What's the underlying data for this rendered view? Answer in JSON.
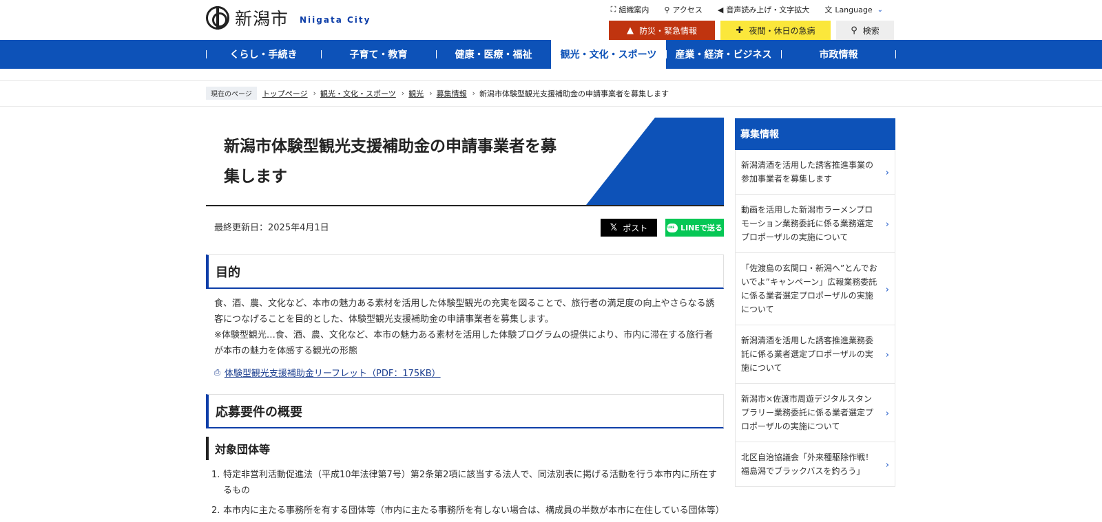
{
  "header": {
    "logo_jp": "新潟市",
    "logo_en": "Niigata City",
    "util_links": [
      {
        "icon": "org-chart-icon",
        "glyph": "⛶",
        "label": "組織案内"
      },
      {
        "icon": "map-pin-icon",
        "glyph": "⚲",
        "label": "アクセス"
      },
      {
        "icon": "speaker-icon",
        "glyph": "◀",
        "label": "音声読み上げ・文字拡大"
      }
    ],
    "language_label": "Language",
    "disaster_label": "防災・緊急情報",
    "emergency_label": "夜間・休日の急病",
    "search_label": "検索"
  },
  "gnav": [
    "くらし・手続き",
    "子育て・教育",
    "健康・医療・福祉",
    "観光・文化・スポーツ",
    "産業・経済・ビジネス",
    "市政情報"
  ],
  "breadcrumb": {
    "tag": "現在のページ",
    "links": [
      "トップページ",
      "観光・文化・スポーツ",
      "観光",
      "募集情報"
    ],
    "current": "新潟市体験型観光支援補助金の申請事業者を募集します"
  },
  "article": {
    "title_line1": "新潟市体験型観光支援補助金の申請事業者を募",
    "title_line2": "集します",
    "updated": "最終更新日：2025年4月1日",
    "share_x": "ポスト",
    "share_line": "LINEで送る",
    "section1_heading": "目的",
    "section1_para1": "食、酒、農、文化など、本市の魅力ある素材を活用した体験型観光の充実を図ることで、旅行者の満足度の向上やさらなる誘客につなげることを目的とした、体験型観光支援補助金の申請事業者を募集します。",
    "section1_para2": "※体験型観光…食、酒、農、文化など、本市の魅力ある素材を活用した体験プログラムの提供により、市内に滞在する旅行者が本市の魅力を体感する観光の形態",
    "pdf_link": "体験型観光支援補助金リーフレット（PDF：175KB）",
    "section2_heading": "応募要件の概要",
    "subsection_heading": "対象団体等",
    "list": [
      {
        "num": "1.",
        "text": "特定非営利活動促進法（平成10年法律第7号）第2条第2項に該当する法人で、同法別表に掲げる活動を行う本市内に所在するもの"
      },
      {
        "num": "2.",
        "text": "本市内に主たる事務所を有する団体等（市内に主たる事務所を有しない場合は、構成員の半数が本市に在住している団体等）"
      }
    ]
  },
  "sidebar": {
    "heading": "募集情報",
    "items": [
      "新潟清酒を活用した誘客推進事業の参加事業者を募集します",
      "動画を活用した新潟市ラーメンプロモーション業務委託に係る業務選定プロポーザルの実施について",
      "「佐渡島の玄関口・新潟へ”とんでおいでよ”キャンペーン」広報業務委託に係る業者選定プロポーザルの実施について",
      "新潟清酒を活用した誘客推進業務委託に係る業者選定プロポーザルの実施について",
      "新潟市×佐渡市周遊デジタルスタンプラリー業務委託に係る業者選定プロポーザルの実施について",
      "北区自治協議会「外来種駆除作戦！福島潟でブラックバスを釣ろう」"
    ]
  },
  "colors": {
    "nav_blue": "#0d52b8",
    "heading_blue": "#0d3ea8",
    "disaster_red": "#c0340f",
    "emergency_yellow": "#fbe73b",
    "line_green": "#06c755"
  }
}
